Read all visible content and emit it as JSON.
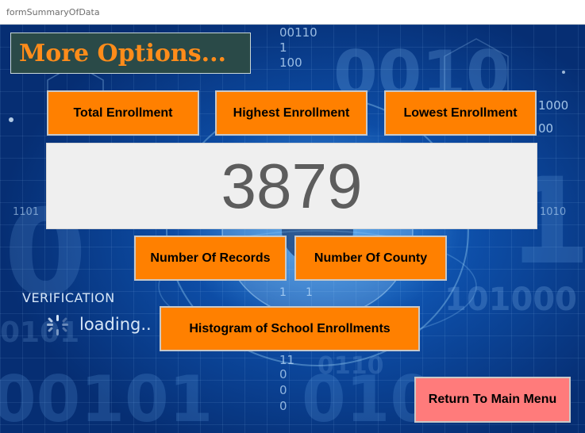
{
  "window": {
    "title": "formSummaryOfData"
  },
  "header": {
    "label": "More Options..."
  },
  "buttons": {
    "total_enrollment": "Total Enrollment",
    "highest_enrollment": "Highest Enrollment",
    "lowest_enrollment": "Lowest Enrollment",
    "number_of_records": "Number Of Records",
    "number_of_county": "Number Of County",
    "histogram": "Histogram of School Enrollments",
    "return_main_menu": "Return To Main Menu"
  },
  "display": {
    "value": "3879"
  },
  "background": {
    "verification_text": "VERIFICATION",
    "loading_text": "loading..",
    "binary_text": [
      "00110",
      "1",
      "100",
      "1000",
      "00",
      "1101",
      "1010",
      "101000",
      "0101",
      "0110",
      "11",
      "0",
      "0",
      "0",
      "1",
      "1"
    ]
  },
  "colors": {
    "button_orange": "#ff8000",
    "return_button": "#ff7b7b",
    "header_text": "#ff8c1a",
    "header_bg": "#2a4a48",
    "display_bg": "#efefef",
    "display_text": "#5d5d5d"
  }
}
